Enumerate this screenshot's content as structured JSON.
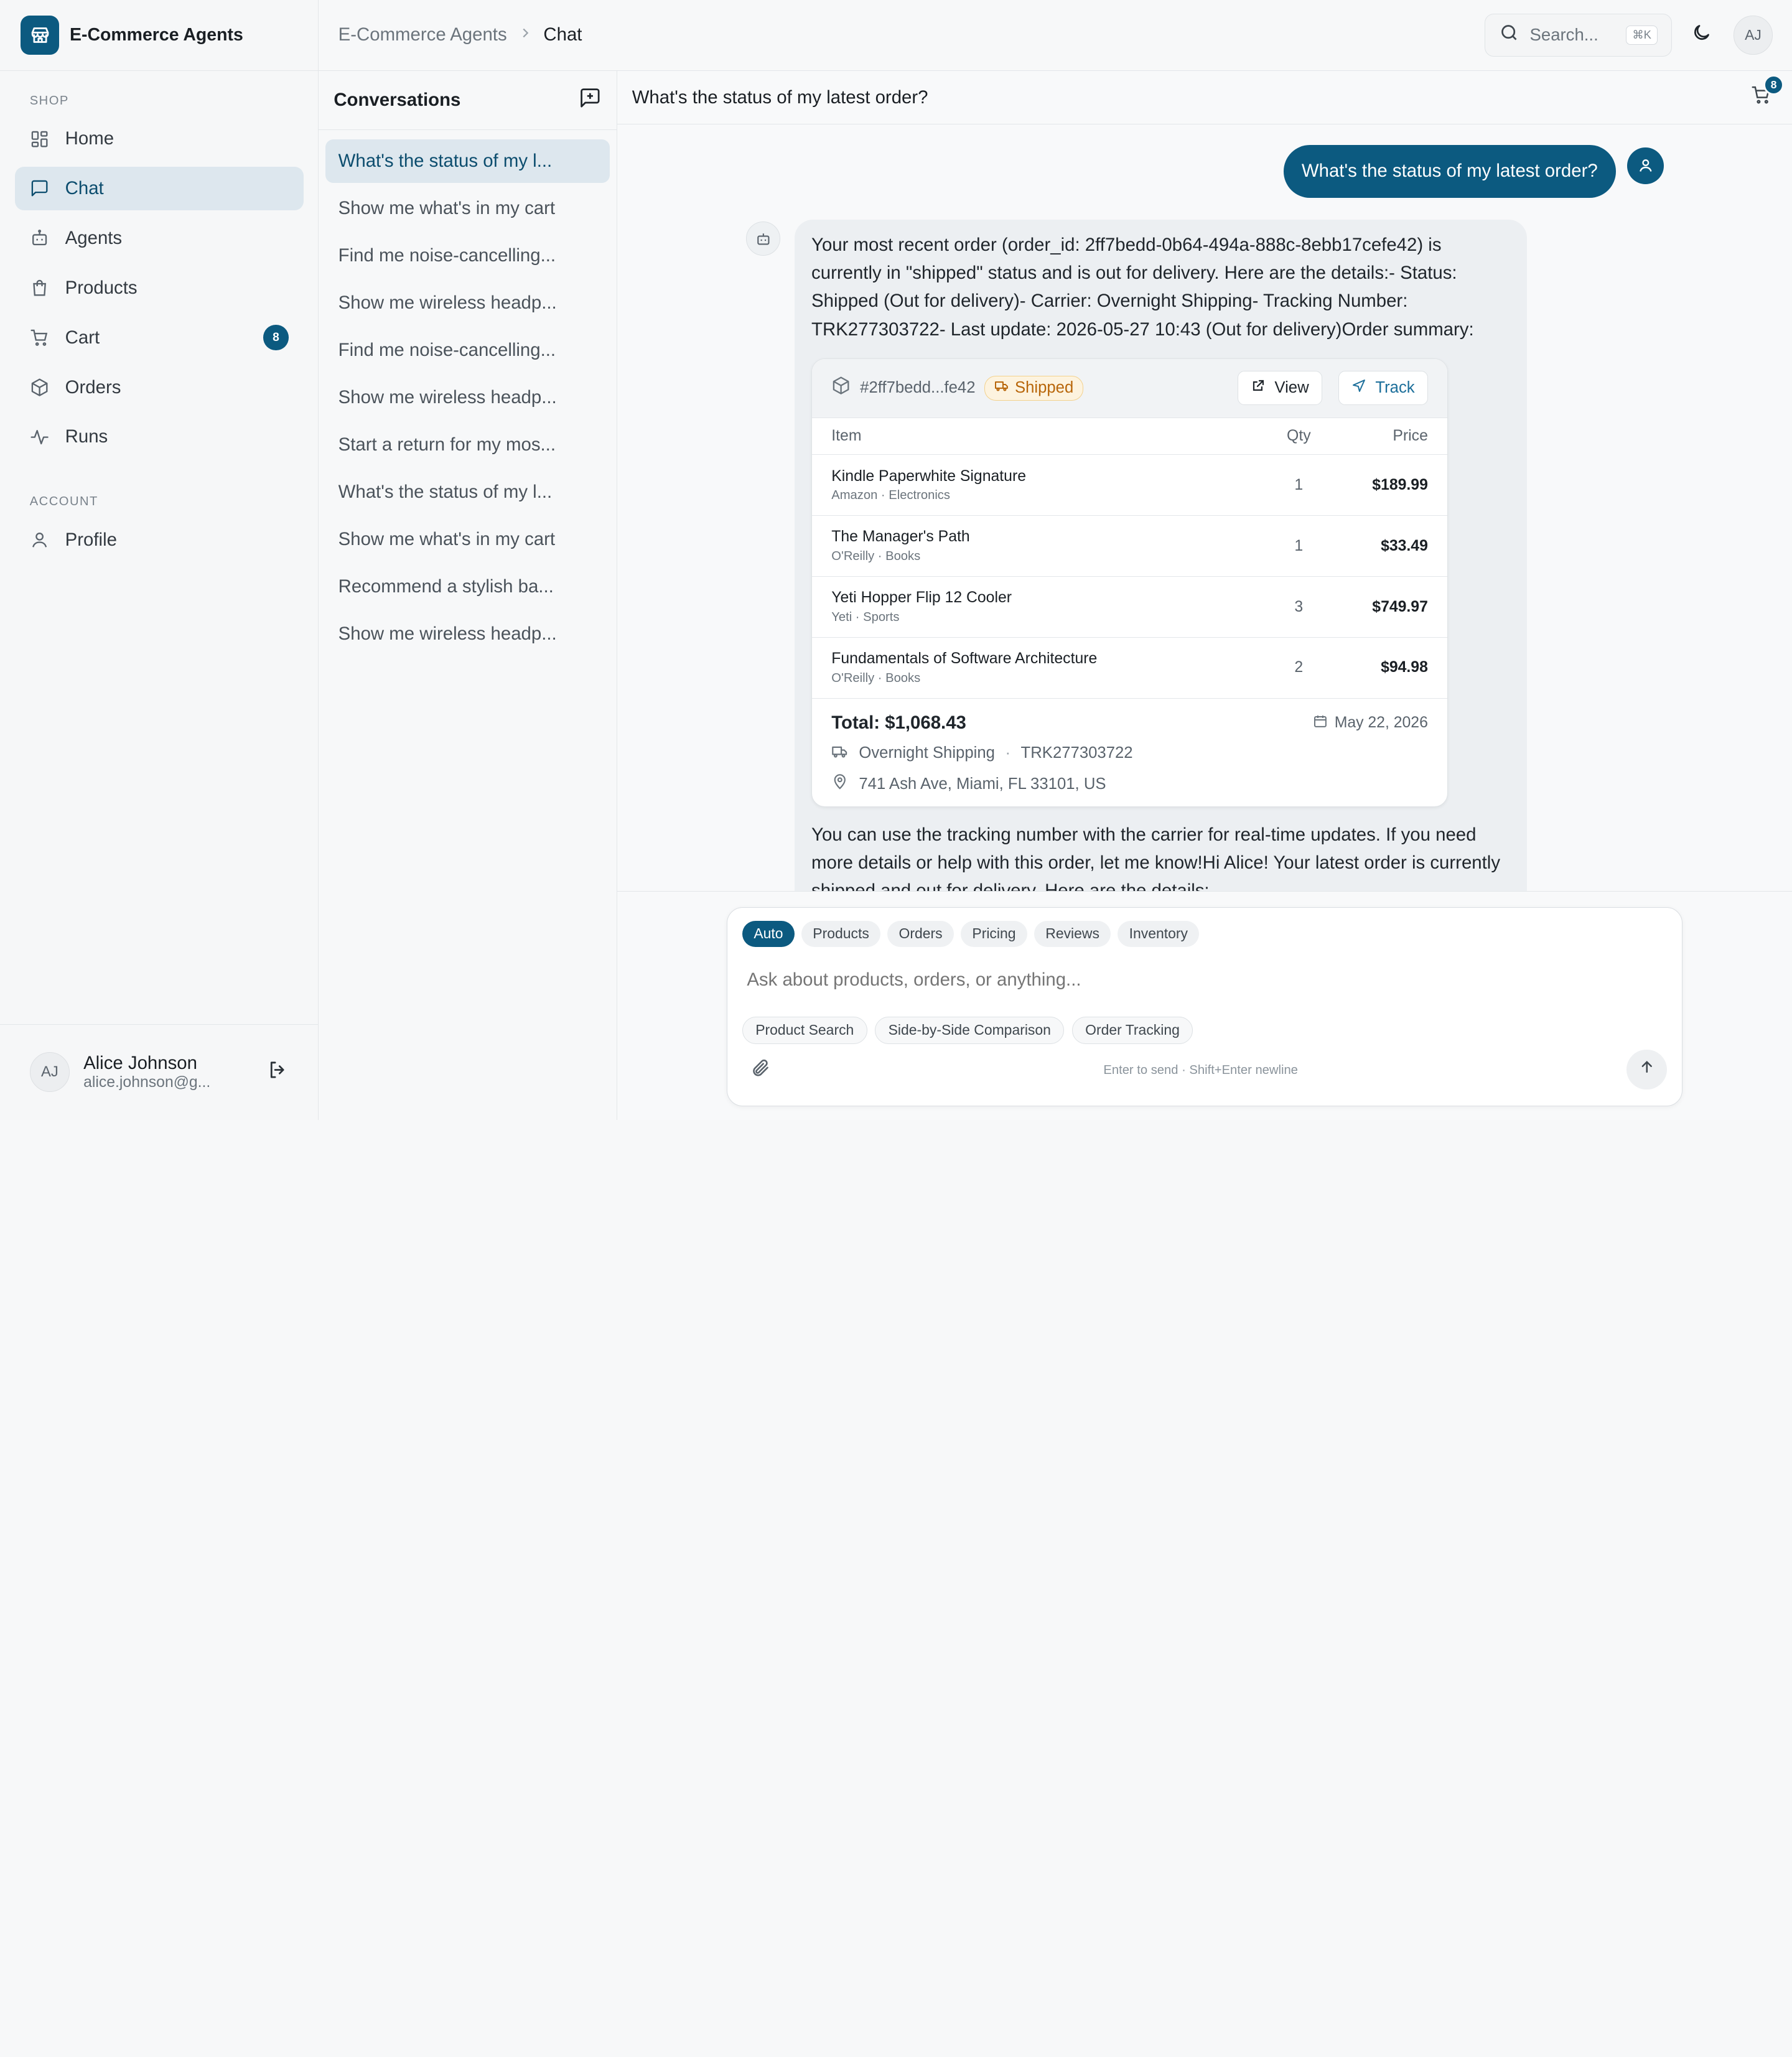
{
  "app": {
    "title": "E-Commerce Agents"
  },
  "sidebar": {
    "shop_label": "SHOP",
    "account_label": "ACCOUNT",
    "items": [
      {
        "label": "Home"
      },
      {
        "label": "Chat"
      },
      {
        "label": "Agents"
      },
      {
        "label": "Products"
      },
      {
        "label": "Cart",
        "badge": "8"
      },
      {
        "label": "Orders"
      },
      {
        "label": "Runs"
      }
    ],
    "account_items": [
      {
        "label": "Profile"
      }
    ]
  },
  "user": {
    "initials": "AJ",
    "name": "Alice Johnson",
    "email": "alice.johnson@g..."
  },
  "header": {
    "breadcrumb_root": "E-Commerce Agents",
    "breadcrumb_current": "Chat",
    "search_placeholder": "Search...",
    "search_shortcut": "⌘K",
    "avatar_initials": "AJ"
  },
  "conversations": {
    "title": "Conversations",
    "items": [
      "What's the status of my l...",
      "Show me what's in my cart",
      "Find me noise-cancelling...",
      "Show me wireless headp...",
      "Find me noise-cancelling...",
      "Show me wireless headp...",
      "Start a return for my mos...",
      "What's the status of my l...",
      "Show me what's in my cart",
      "Recommend a stylish ba...",
      "Show me wireless headp..."
    ]
  },
  "chat": {
    "title": "What's the status of my latest order?",
    "cart_count": "8",
    "user_message": "What's the status of my latest order?",
    "bot_intro": "Your most recent order (order_id: 2ff7bedd-0b64-494a-888c-8ebb17cefe42) is currently in \"shipped\" status and is out for delivery. Here are the details:- Status: Shipped (Out for delivery)- Carrier: Overnight Shipping- Tracking Number: TRK277303722- Last update: 2026-05-27 10:43 (Out for delivery)Order summary:",
    "bot_outro": "You can use the tracking number with the carrier for real-time updates. If you need more details or help with this order, let me know!Hi Alice! Your latest order is currently shipped and out for delivery. Here are the details:"
  },
  "order": {
    "id": "#2ff7bedd...fe42",
    "status": "Shipped",
    "status_color": "#b8660a",
    "view_label": "View",
    "track_label": "Track",
    "columns": {
      "item": "Item",
      "qty": "Qty",
      "price": "Price"
    },
    "rows": [
      {
        "name": "Kindle Paperwhite Signature",
        "sub": "Amazon · Electronics",
        "qty": "1",
        "price": "$189.99"
      },
      {
        "name": "The Manager's Path",
        "sub": "O'Reilly · Books",
        "qty": "1",
        "price": "$33.49"
      },
      {
        "name": "Yeti Hopper Flip 12 Cooler",
        "sub": "Yeti · Sports",
        "qty": "3",
        "price": "$749.97"
      },
      {
        "name": "Fundamentals of Software Architecture",
        "sub": "O'Reilly · Books",
        "qty": "2",
        "price": "$94.98"
      }
    ],
    "total": "Total: $1,068.43",
    "date": "May 22, 2026",
    "carrier": "Overnight Shipping",
    "tracking": "TRK277303722",
    "address": "741 Ash Ave, Miami, FL 33101, US"
  },
  "composer": {
    "modes": [
      "Auto",
      "Products",
      "Orders",
      "Pricing",
      "Reviews",
      "Inventory"
    ],
    "active_mode": "Auto",
    "placeholder": "Ask about products, orders, or anything...",
    "quick_actions": [
      "Product Search",
      "Side-by-Side Comparison",
      "Order Tracking"
    ],
    "hint": "Enter to send · Shift+Enter newline"
  },
  "colors": {
    "brand": "#0c5a80",
    "active_bg": "#dde7ee"
  }
}
